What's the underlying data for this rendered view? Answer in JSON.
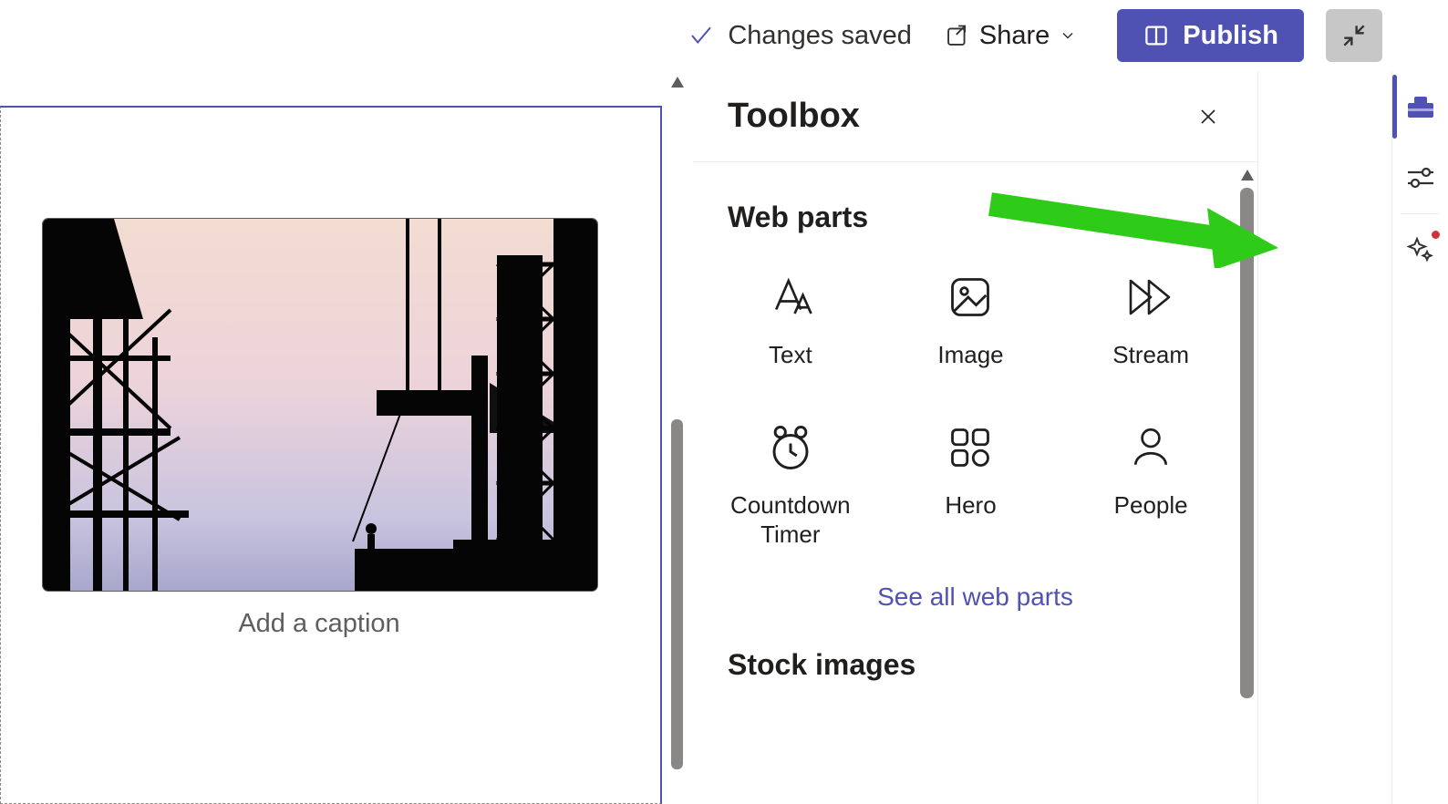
{
  "topbar": {
    "saved_label": "Changes saved",
    "share_label": "Share",
    "publish_label": "Publish"
  },
  "canvas": {
    "caption_placeholder": "Add a caption"
  },
  "panel": {
    "title": "Toolbox",
    "web_parts_heading": "Web parts",
    "see_all_label": "See all web parts",
    "stock_images_heading": "Stock images",
    "items": [
      {
        "label": "Text",
        "icon": "text-icon"
      },
      {
        "label": "Image",
        "icon": "image-icon"
      },
      {
        "label": "Stream",
        "icon": "stream-icon"
      },
      {
        "label": "Countdown Timer",
        "icon": "clock-icon"
      },
      {
        "label": "Hero",
        "icon": "grid-icon"
      },
      {
        "label": "People",
        "icon": "person-icon"
      }
    ]
  },
  "rail": {
    "items": [
      {
        "name": "toolbox",
        "active": true,
        "has_dot": false
      },
      {
        "name": "settings",
        "active": false,
        "has_dot": false
      },
      {
        "name": "ai",
        "active": false,
        "has_dot": true
      }
    ]
  }
}
